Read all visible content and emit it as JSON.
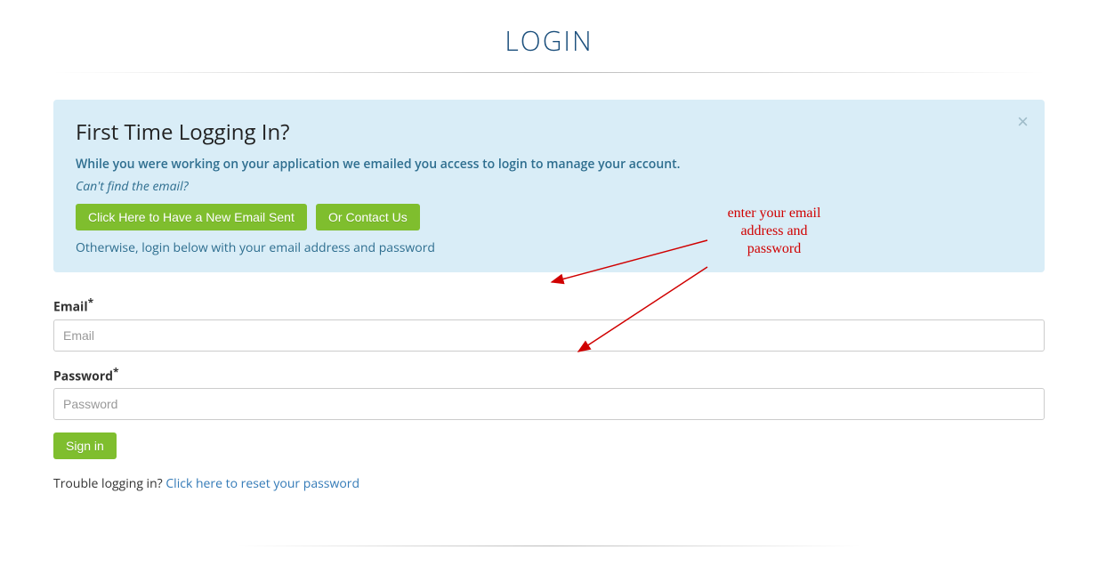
{
  "page_title": "LOGIN",
  "alert": {
    "heading": "First Time Logging In?",
    "lead": "While you were working on your application we emailed you access to login to manage your account.",
    "hint": "Can't find the email?",
    "resend_label": "Click Here to Have a New Email Sent",
    "contact_label": "Or Contact Us",
    "otherwise": "Otherwise, login below with your email address and password",
    "close_glyph": "×"
  },
  "form": {
    "email": {
      "label": "Email",
      "required": "*",
      "placeholder": "Email",
      "value": ""
    },
    "password": {
      "label": "Password",
      "required": "*",
      "placeholder": "Password",
      "value": ""
    },
    "submit_label": "Sign in"
  },
  "trouble": {
    "prefix": "Trouble logging in? ",
    "link_text": "Click here to reset your password"
  },
  "annotation": {
    "text": "enter your email\naddress and\npassword"
  }
}
